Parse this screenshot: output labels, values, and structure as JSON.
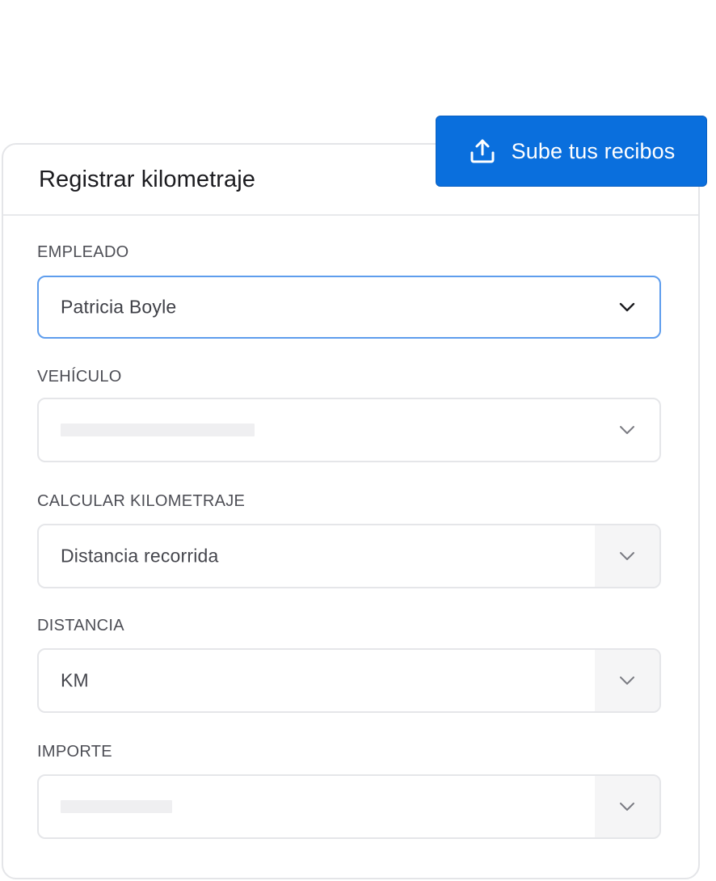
{
  "card": {
    "title": "Registrar kilometraje"
  },
  "upload_button": {
    "label": "Sube tus recibos",
    "icon": "upload-icon",
    "color": "#0a6fdd"
  },
  "fields": {
    "employee": {
      "label": "EMPLEADO",
      "value": "Patricia Boyle",
      "icon": "chevron-down-icon"
    },
    "vehicle": {
      "label": "VEHÍCULO",
      "value": "",
      "icon": "chevron-down-icon"
    },
    "calculate": {
      "label": "CALCULAR KILOMETRAJE",
      "value": "Distancia recorrida",
      "icon": "chevron-down-icon"
    },
    "distance": {
      "label": "DISTANCIA",
      "value": "KM",
      "icon": "chevron-down-icon"
    },
    "amount": {
      "label": "IMPORTE",
      "value": "",
      "icon": "chevron-down-icon"
    }
  },
  "colors": {
    "accent": "#0a6fdd",
    "focus_border": "#5e9ded"
  }
}
